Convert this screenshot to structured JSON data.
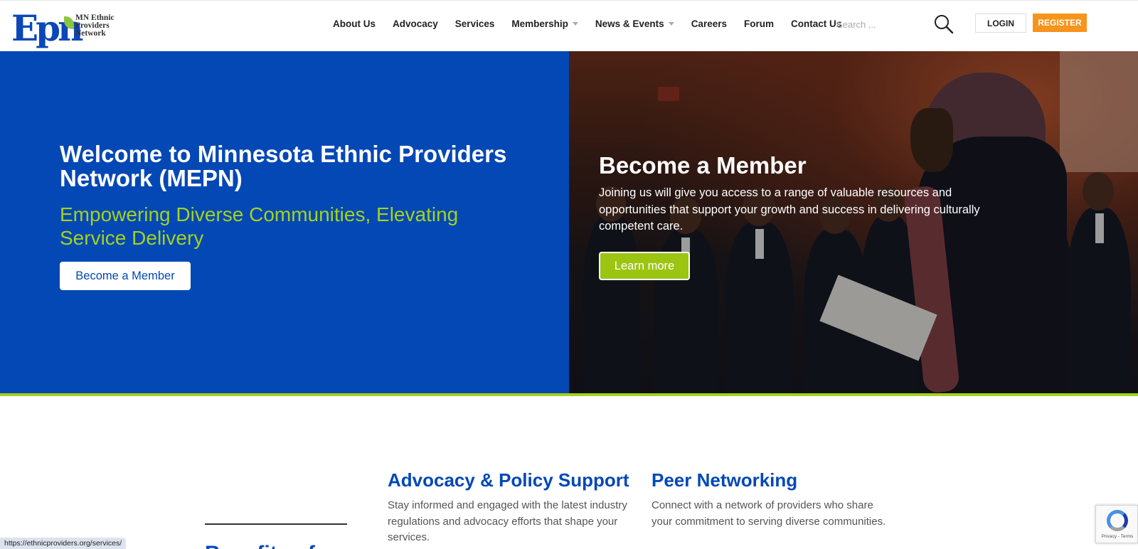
{
  "header": {
    "logo_mark": "Epn",
    "logo_text_lines": [
      "MN Ethnic",
      "Providers",
      "Network"
    ],
    "nav": [
      {
        "label": "About Us",
        "dropdown": false
      },
      {
        "label": "Advocacy",
        "dropdown": false
      },
      {
        "label": "Services",
        "dropdown": false
      },
      {
        "label": "Membership",
        "dropdown": true
      },
      {
        "label": "News & Events",
        "dropdown": true
      },
      {
        "label": "Careers",
        "dropdown": false
      },
      {
        "label": "Forum",
        "dropdown": false
      },
      {
        "label": "Contact Us",
        "dropdown": false
      }
    ],
    "search_placeholder": "Search ...",
    "login_label": "LOGIN",
    "register_label": "REGISTER"
  },
  "hero": {
    "title": "Welcome to Minnesota Ethnic Providers Network (MEPN)",
    "subtitle": "Empowering Diverse Communities, Elevating Service Delivery",
    "cta_label": "Become a Member"
  },
  "member_panel": {
    "title": "Become a Member",
    "text": "Joining us will give you access to a range of valuable resources and opportunities that support your growth and success in delivering culturally competent care.",
    "button_label": "Learn more"
  },
  "features": [
    {
      "title": "Advocacy & Policy Support",
      "text": "Stay informed and engaged with the latest industry regulations and advocacy efforts that shape your services."
    },
    {
      "title": "Peer Networking",
      "text": "Connect with a network of providers who share your commitment to serving diverse communities."
    }
  ],
  "benefits_heading": "Benefits of",
  "status_bar_url": "https://ethnicproviders.org/services/",
  "recaptcha_text": "Privacy - Terms",
  "colors": {
    "brand_blue": "#0448b6",
    "accent_green": "#a4d21c",
    "register_orange": "#f7941d"
  }
}
